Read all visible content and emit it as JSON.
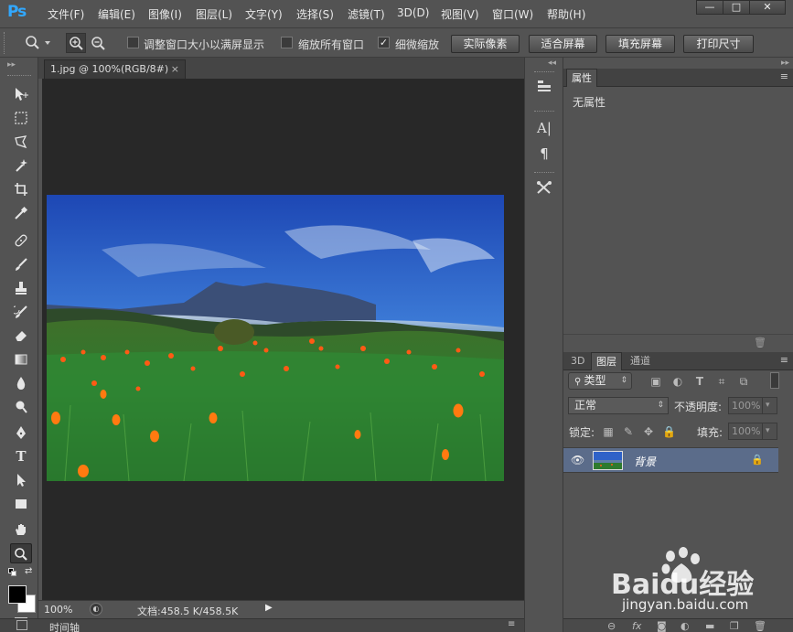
{
  "app": {
    "logo": "Ps"
  },
  "menu": [
    "文件(F)",
    "编辑(E)",
    "图像(I)",
    "图层(L)",
    "文字(Y)",
    "选择(S)",
    "滤镜(T)",
    "3D(D)",
    "视图(V)",
    "窗口(W)",
    "帮助(H)"
  ],
  "window_controls": {
    "minimize": "—",
    "restore": "□",
    "close": "✕"
  },
  "options": {
    "resize_windows": {
      "label": "调整窗口大小以满屏显示",
      "checked": false,
      "mark": ""
    },
    "zoom_all": {
      "label": "缩放所有窗口",
      "checked": false,
      "mark": ""
    },
    "scrubby_zoom": {
      "label": "细微缩放",
      "checked": true,
      "mark": "✓"
    },
    "buttons": [
      "实际像素",
      "适合屏幕",
      "填充屏幕",
      "打印尺寸"
    ]
  },
  "document": {
    "tab_title": "1.jpg @ 100%(RGB/8#)",
    "tab_close": "×",
    "zoom": "100%",
    "doc_info": "文档:458.5 K/458.5K"
  },
  "timeline": {
    "label": "时间轴"
  },
  "properties": {
    "tab": "属性",
    "content": "无属性"
  },
  "layers_panel": {
    "tabs": [
      "3D",
      "图层",
      "通道"
    ],
    "active_tab": "图层",
    "filter_kind": "类型",
    "blend_mode": "正常",
    "opacity_label": "不透明度:",
    "opacity_value": "100%",
    "lock_label": "锁定:",
    "fill_label": "填充:",
    "fill_value": "100%",
    "layers": [
      {
        "name": "背景",
        "visible": true,
        "locked": true
      }
    ]
  },
  "watermark": {
    "brand": "Baidu经验",
    "url": "jingyan.baidu.com"
  },
  "colors": {
    "accent": "#31a8ff",
    "selected_layer": "#5b6c8a",
    "canvas_bg": "#282828",
    "ui_bg": "#535353"
  }
}
